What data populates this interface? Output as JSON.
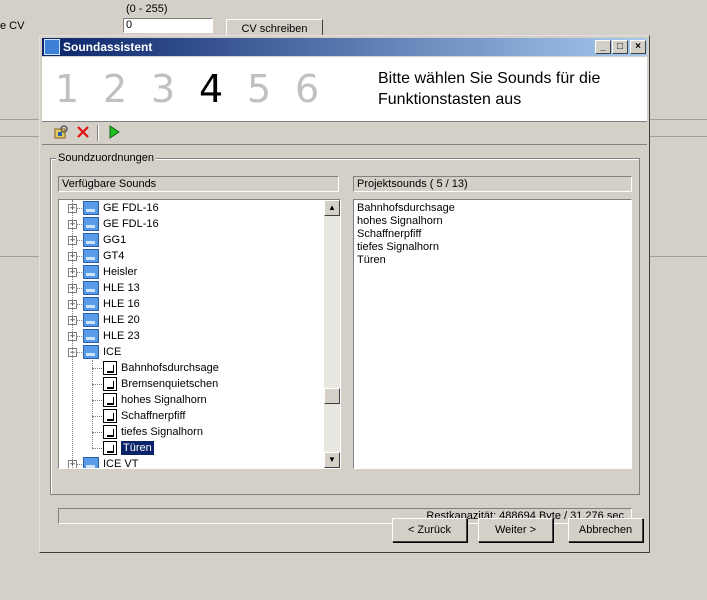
{
  "background": {
    "range_label": "(0 - 255)",
    "cv_label": "e CV",
    "cv_value": "0",
    "write_button": "CV schreiben"
  },
  "dialog": {
    "title": "Soundassistent",
    "steps": [
      "1",
      "2",
      "3",
      "4",
      "5",
      "6"
    ],
    "active_step": "4",
    "instruction": "Bitte wählen Sie Sounds für die Funktionstasten aus",
    "toolbar": {
      "icons": [
        "import-icon",
        "delete-icon",
        "play-icon"
      ]
    },
    "group_label": "Soundzuordnungen",
    "available": {
      "header": "Verfügbare Sounds",
      "items": [
        {
          "label": "GE FDL-16",
          "type": "folder",
          "expanded": false
        },
        {
          "label": "GE FDL-16",
          "type": "folder",
          "expanded": false
        },
        {
          "label": "GG1",
          "type": "folder",
          "expanded": false
        },
        {
          "label": "GT4",
          "type": "folder",
          "expanded": false
        },
        {
          "label": "Heisler",
          "type": "folder",
          "expanded": false
        },
        {
          "label": "HLE 13",
          "type": "folder",
          "expanded": false
        },
        {
          "label": "HLE 16",
          "type": "folder",
          "expanded": false
        },
        {
          "label": "HLE 20",
          "type": "folder",
          "expanded": false
        },
        {
          "label": "HLE 23",
          "type": "folder",
          "expanded": false
        },
        {
          "label": "ICE",
          "type": "folder",
          "expanded": true
        },
        {
          "label": "Bahnhofsdurchsage",
          "type": "sound"
        },
        {
          "label": "Bremsenquietschen",
          "type": "sound"
        },
        {
          "label": "hohes Signalhorn",
          "type": "sound"
        },
        {
          "label": "Schaffnerpfiff",
          "type": "sound"
        },
        {
          "label": "tiefes Signalhorn",
          "type": "sound"
        },
        {
          "label": "Türen",
          "type": "sound",
          "selected": true
        },
        {
          "label": "ICE VT",
          "type": "folder",
          "expanded": false
        }
      ]
    },
    "project": {
      "header": "Projektsounds ( 5 / 13)",
      "items": [
        "Bahnhofsdurchsage",
        "hohes Signalhorn",
        "Schaffnerpfiff",
        "tiefes Signalhorn",
        "Türen"
      ]
    },
    "status": "Restkapazität: 488694 Byte / 31,276 sec.",
    "buttons": {
      "back": "< Zurück",
      "next": "Weiter >",
      "cancel": "Abbrechen"
    }
  }
}
